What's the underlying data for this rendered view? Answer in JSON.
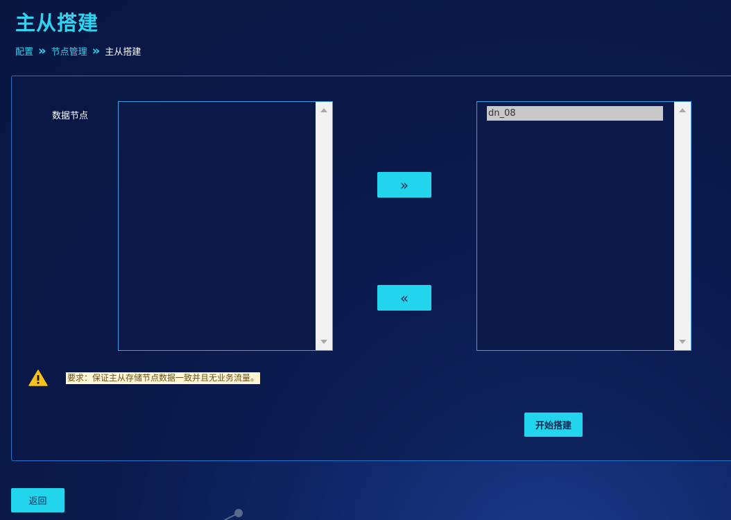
{
  "page": {
    "title": "主从搭建"
  },
  "breadcrumb": {
    "items": [
      {
        "label": "配置"
      },
      {
        "label": "节点管理"
      },
      {
        "label": "主从搭建"
      }
    ],
    "separator": "»"
  },
  "form": {
    "data_node_label": "数据节点",
    "available_list": {
      "items": []
    },
    "selected_list": {
      "items": [
        "dn_08"
      ]
    },
    "move_right_label": "»",
    "move_left_label": "«",
    "warning_text": "要求：保证主从存储节点数据一致并且无业务流量。",
    "start_button_label": "开始搭建"
  },
  "footer": {
    "back_button_label": "返回"
  },
  "colors": {
    "accent": "#22d4ec",
    "title": "#2fd4f0",
    "panel_border": "#2a73c8",
    "warning_bg": "#fff6d6",
    "warning_icon": "#f7c31a"
  }
}
